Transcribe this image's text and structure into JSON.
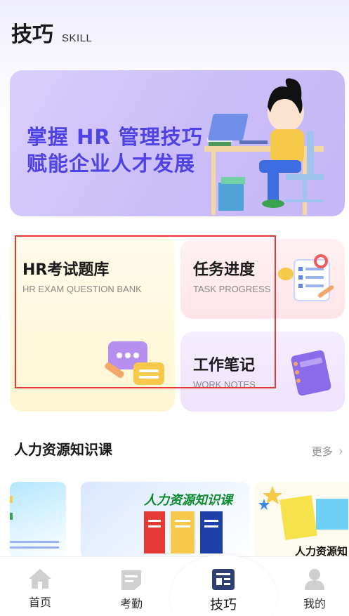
{
  "header": {
    "title": "技巧",
    "subtitle": "SKILL"
  },
  "banner": {
    "line1": "掌握 HR 管理技巧",
    "line2": "赋能企业人才发展"
  },
  "cards": {
    "exam": {
      "title": "HR考试题库",
      "subtitle": "HR EXAM QUESTION BANK"
    },
    "task": {
      "title": "任务进度",
      "subtitle": "TASK PROGRESS"
    },
    "notes": {
      "title": "工作笔记",
      "subtitle": "WORK NOTES"
    }
  },
  "section": {
    "title": "人力资源知识课",
    "more": "更多",
    "more_icon": "chevron-right-icon"
  },
  "courses": [
    {
      "title": ""
    },
    {
      "title": "人力资源知识课"
    },
    {
      "title": "人力资源知"
    }
  ],
  "tabs": [
    {
      "label": "首页",
      "icon": "home-icon"
    },
    {
      "label": "考勤",
      "icon": "attendance-icon"
    },
    {
      "label": "技巧",
      "icon": "skill-icon",
      "active": true
    },
    {
      "label": "我的",
      "icon": "profile-icon"
    }
  ],
  "colors": {
    "accent": "#4f43e7",
    "highlight": "#e53935",
    "active_tab": "#2f3f73",
    "inactive_tab": "#cfcfcf"
  }
}
